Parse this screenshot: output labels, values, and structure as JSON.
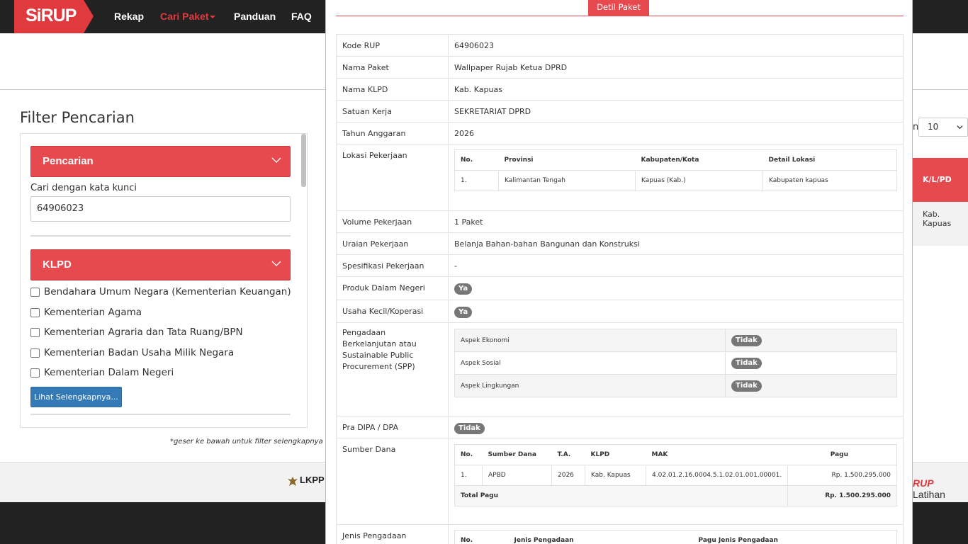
{
  "navbar": {
    "logo": "SiRUP",
    "items": [
      "Rekap",
      "Cari Paket",
      "Panduan",
      "FAQ"
    ],
    "active": "Cari Paket"
  },
  "filter": {
    "title": "Filter Pencarian",
    "search_section": "Pencarian",
    "keyword_label": "Cari dengan kata kunci",
    "keyword_value": "64906023",
    "klpd_section": "KLPD",
    "klpd_options": [
      "Bendahara Umum Negara (Kementerian Keuangan)",
      "Kementerian Agama",
      "Kementerian Agraria dan Tata Ruang/BPN",
      "Kementerian Badan Usaha Milik Negara",
      "Kementerian Dalam Negeri"
    ],
    "more_button": "Lihat Selengkapnya...",
    "hint": "*geser ke bawah untuk filter selengkapnya"
  },
  "results": {
    "show_label": "n",
    "page_size": "10",
    "column_header": "K/L/PD",
    "cell_value": "Kab. Kapuas"
  },
  "footer": {
    "lkpp": "LKPP",
    "sirup_brand": "RUP",
    "sirup_suffix": "Latihan"
  },
  "modal": {
    "tab_title": "Detil Paket",
    "rows": {
      "kode_rup": {
        "label": "Kode RUP",
        "value": "64906023"
      },
      "nama_paket": {
        "label": "Nama Paket",
        "value": "Wallpaper Rujab Ketua DPRD"
      },
      "nama_klpd": {
        "label": "Nama KLPD",
        "value": "Kab. Kapuas"
      },
      "satuan_kerja": {
        "label": "Satuan Kerja",
        "value": "SEKRETARIAT DPRD"
      },
      "tahun_anggaran": {
        "label": "Tahun Anggaran",
        "value": "2026"
      },
      "lokasi": {
        "label": "Lokasi Pekerjaan"
      },
      "volume": {
        "label": "Volume Pekerjaan",
        "value": "1 Paket"
      },
      "uraian": {
        "label": "Uraian Pekerjaan",
        "value": "Belanja Bahan-bahan Bangunan dan Konstruksi"
      },
      "spesifikasi": {
        "label": "Spesifikasi Pekerjaan",
        "value": "-"
      },
      "pdn": {
        "label": "Produk Dalam Negeri",
        "value": "Ya"
      },
      "ukm": {
        "label": "Usaha Kecil/Koperasi",
        "value": "Ya"
      },
      "spp": {
        "label": "Pengadaan Berkelanjutan atau Sustainable Public Procurement (SPP)"
      },
      "pra_dipa": {
        "label": "Pra DIPA / DPA",
        "value": "Tidak"
      },
      "sumber_dana": {
        "label": "Sumber Dana"
      },
      "jenis_pengadaan": {
        "label": "Jenis Pengadaan"
      }
    },
    "lokasi_table": {
      "headers": [
        "No.",
        "Provinsi",
        "Kabupaten/Kota",
        "Detail Lokasi"
      ],
      "rows": [
        [
          "1.",
          "Kalimantan Tengah",
          "Kapuas (Kab.)",
          "Kabupaten kapuas"
        ]
      ]
    },
    "spp_table": {
      "rows": [
        [
          "Aspek Ekonomi",
          "Tidak"
        ],
        [
          "Aspek Sosial",
          "Tidak"
        ],
        [
          "Aspek Lingkungan",
          "Tidak"
        ]
      ]
    },
    "dana_table": {
      "headers": [
        "No.",
        "Sumber Dana",
        "T.A.",
        "KLPD",
        "MAK",
        "Pagu"
      ],
      "rows": [
        [
          "1.",
          "APBD",
          "2026",
          "Kab. Kapuas",
          "4.02.01.2.16.0004.5.1.02.01.001.00001.",
          "Rp. 1.500.295.000"
        ]
      ],
      "total_label": "Total Pagu",
      "total_value": "Rp. 1.500.295.000"
    },
    "jenis_table": {
      "headers": [
        "No.",
        "Jenis Pengadaan",
        "Pagu Jenis Pengadaan"
      ]
    }
  }
}
